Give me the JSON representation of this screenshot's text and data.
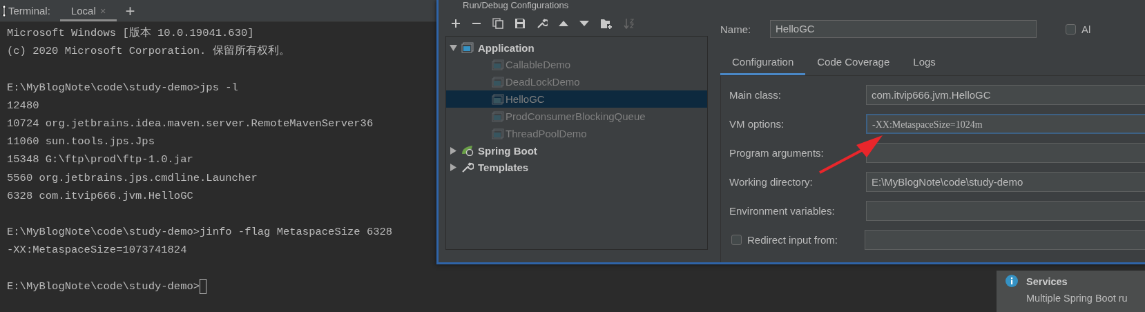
{
  "terminal": {
    "label": "Terminal:",
    "tabs": [
      {
        "label": "Local",
        "selected": true,
        "close": "×"
      }
    ],
    "add_button": "+",
    "blocks": [
      [
        "Microsoft Windows [版本 10.0.19041.630]",
        "(c) 2020 Microsoft Corporation. 保留所有权利。"
      ],
      [
        "E:\\MyBlogNote\\code\\study-demo>jps -l",
        "12480",
        "10724 org.jetbrains.idea.maven.server.RemoteMavenServer36",
        "11060 sun.tools.jps.Jps",
        "15348 G:\\ftp\\prod\\ftp-1.0.jar",
        "5560 org.jetbrains.jps.cmdline.Launcher",
        "6328 com.itvip666.jvm.HelloGC"
      ],
      [
        "E:\\MyBlogNote\\code\\study-demo>jinfo -flag MetaspaceSize 6328",
        "-XX:MetaspaceSize=1073741824"
      ],
      [
        "E:\\MyBlogNote\\code\\study-demo>"
      ]
    ]
  },
  "dialog": {
    "title": "Run/Debug Configurations",
    "tree": [
      {
        "label": "Application",
        "kind": "application",
        "expanded": true,
        "children": [
          {
            "label": "CallableDemo",
            "selected": false
          },
          {
            "label": "DeadLockDemo",
            "selected": false
          },
          {
            "label": "HelloGC",
            "selected": true
          },
          {
            "label": "ProdConsumerBlockingQueue",
            "selected": false
          },
          {
            "label": "ThreadPoolDemo",
            "selected": false
          }
        ]
      },
      {
        "label": "Spring Boot",
        "kind": "spring",
        "expanded": false
      },
      {
        "label": "Templates",
        "kind": "templates",
        "expanded": false
      }
    ],
    "name": {
      "label": "Name:",
      "value": "HelloGC"
    },
    "allow_checkbox": {
      "label": "Al",
      "checked": false
    },
    "tabs": [
      {
        "label": "Configuration",
        "selected": true
      },
      {
        "label": "Code Coverage",
        "selected": false
      },
      {
        "label": "Logs",
        "selected": false
      }
    ],
    "form": [
      {
        "kind": "field",
        "label": "Main class:",
        "value": "com.itvip666.jvm.HelloGC",
        "focused": false
      },
      {
        "kind": "field",
        "label": "VM options:",
        "value": "-XX:MetaspaceSize=1024m",
        "focused": true
      },
      {
        "kind": "field",
        "label": "Program arguments:",
        "focused": false
      },
      {
        "kind": "field",
        "label": "Working directory:",
        "value": "E:\\MyBlogNote\\code\\study-demo",
        "focused": false
      },
      {
        "kind": "field",
        "label": "Environment variables:",
        "focused": false
      },
      {
        "kind": "checkbox",
        "label": "Redirect input from:",
        "checked": false
      }
    ]
  },
  "notification": {
    "title": "Services",
    "text": "Multiple Spring Boot ru"
  }
}
